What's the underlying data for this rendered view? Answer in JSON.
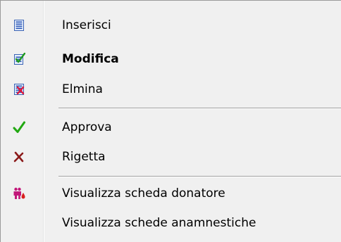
{
  "menu": {
    "items": [
      {
        "label": "Inserisci",
        "icon": "insert-record-icon"
      },
      {
        "label": "Modifica",
        "icon": "edit-record-icon",
        "default": true
      },
      {
        "label": "Elmina",
        "icon": "delete-record-icon"
      },
      {
        "label": "Approva",
        "icon": "green-check-icon"
      },
      {
        "label": "Rigetta",
        "icon": "red-cross-icon"
      },
      {
        "label": "Visualizza scheda donatore",
        "icon": "blood-donor-icon"
      },
      {
        "label": "Visualizza schede anamnestiche",
        "icon": ""
      }
    ]
  },
  "colors": {
    "menu_background": "#f0f0f0",
    "separator": "#a0a0a0",
    "approve_green": "#22a812",
    "reject_red": "#8b1a1a",
    "donor_magenta": "#c2187a"
  }
}
